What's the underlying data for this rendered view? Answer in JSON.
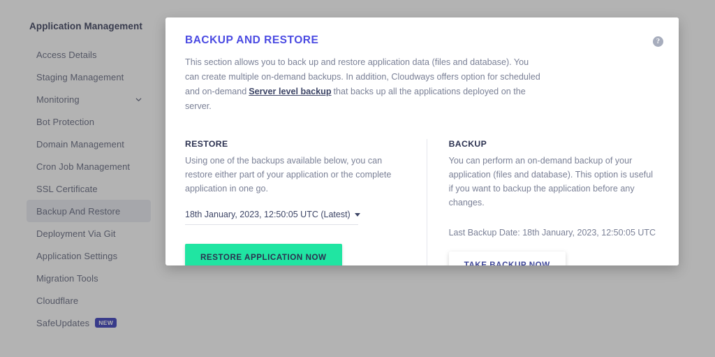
{
  "sidebar": {
    "title": "Application Management",
    "items": [
      {
        "label": "Access Details",
        "name": "access-details",
        "active": false,
        "chevron": false,
        "badge": ""
      },
      {
        "label": "Staging Management",
        "name": "staging-management",
        "active": false,
        "chevron": false,
        "badge": ""
      },
      {
        "label": "Monitoring",
        "name": "monitoring",
        "active": false,
        "chevron": true,
        "badge": ""
      },
      {
        "label": "Bot Protection",
        "name": "bot-protection",
        "active": false,
        "chevron": false,
        "badge": ""
      },
      {
        "label": "Domain Management",
        "name": "domain-management",
        "active": false,
        "chevron": false,
        "badge": ""
      },
      {
        "label": "Cron Job Management",
        "name": "cron-job-management",
        "active": false,
        "chevron": false,
        "badge": ""
      },
      {
        "label": "SSL Certificate",
        "name": "ssl-certificate",
        "active": false,
        "chevron": false,
        "badge": ""
      },
      {
        "label": "Backup And Restore",
        "name": "backup-and-restore",
        "active": true,
        "chevron": false,
        "badge": ""
      },
      {
        "label": "Deployment Via Git",
        "name": "deployment-via-git",
        "active": false,
        "chevron": false,
        "badge": ""
      },
      {
        "label": "Application Settings",
        "name": "application-settings",
        "active": false,
        "chevron": false,
        "badge": ""
      },
      {
        "label": "Migration Tools",
        "name": "migration-tools",
        "active": false,
        "chevron": false,
        "badge": ""
      },
      {
        "label": "Cloudflare",
        "name": "cloudflare",
        "active": false,
        "chevron": false,
        "badge": ""
      },
      {
        "label": "SafeUpdates",
        "name": "safeupdates",
        "active": false,
        "chevron": false,
        "badge": "NEW"
      }
    ]
  },
  "card": {
    "title": "BACKUP AND RESTORE",
    "description_part1": "This section allows you to back up and restore application data (files and database). You can create multiple on-demand backups. In addition, Cloudways offers option for scheduled and on-demand",
    "description_link": "Server level backup",
    "description_part2": "that backs up all the applications deployed on the server.",
    "help_icon": "help-circle-icon",
    "help_glyph": "?"
  },
  "restore": {
    "heading": "RESTORE",
    "text": "Using one of the backups available below, you can restore either part of your application or the complete application in one go.",
    "selected_backup": "18th January, 2023, 12:50:05 UTC (Latest)",
    "dropdown_icon": "caret-down-icon",
    "button_label": "RESTORE APPLICATION NOW"
  },
  "backup": {
    "heading": "BACKUP",
    "text": "You can perform an on-demand backup of your application (files and database). This option is useful if you want to backup the application before any changes.",
    "last_backup_label": "Last Backup Date: 18th January, 2023, 12:50:05 UTC",
    "button_label": "TAKE BACKUP NOW"
  },
  "colors": {
    "title_indigo": "#4a4ae2",
    "green_accent": "#20e5a2",
    "navy_text": "#2b3150",
    "muted_text": "#7a8096",
    "badge_blue": "#2b31b8"
  }
}
